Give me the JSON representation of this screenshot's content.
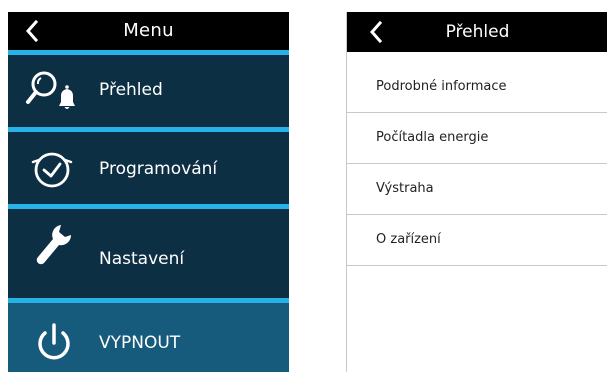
{
  "colors": {
    "header_bg": "#000000",
    "menu_bg": "#0d2f44",
    "power_bg": "#165a7c",
    "divider": "#27b3e8",
    "list_border": "#c8c8c8"
  },
  "menu": {
    "title": "Menu",
    "items": [
      {
        "label": "Přehled",
        "icon": "search-bell-icon"
      },
      {
        "label": "Programování",
        "icon": "clock-icon"
      },
      {
        "label": "Nastavení",
        "icon": "wrench-icon"
      },
      {
        "label": "VYPNOUT",
        "icon": "power-icon"
      }
    ]
  },
  "overview": {
    "title": "Přehled",
    "items": [
      {
        "label": "Podrobné informace"
      },
      {
        "label": "Počítadla energie"
      },
      {
        "label": "Výstraha"
      },
      {
        "label": "O zařízení"
      }
    ]
  }
}
